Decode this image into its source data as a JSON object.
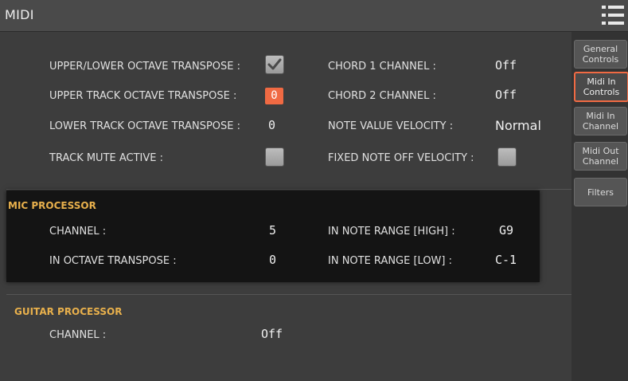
{
  "header": {
    "title": "MIDI",
    "menu_icon": "menu-list-icon"
  },
  "controls": {
    "upper_lower_octave_transpose": {
      "label": "UPPER/LOWER OCTAVE TRANSPOSE :",
      "checked": true
    },
    "upper_track_octave_transpose": {
      "label": "UPPER TRACK OCTAVE TRANSPOSE :",
      "value": "0"
    },
    "lower_track_octave_transpose": {
      "label": "LOWER TRACK OCTAVE TRANSPOSE :",
      "value": "0"
    },
    "track_mute_active": {
      "label": "TRACK MUTE ACTIVE :",
      "checked": false
    },
    "chord1_channel": {
      "label": "CHORD 1 CHANNEL :",
      "value": "Off"
    },
    "chord2_channel": {
      "label": "CHORD 2 CHANNEL :",
      "value": "Off"
    },
    "note_value_velocity": {
      "label": "NOTE VALUE VELOCITY :",
      "value": "Normal"
    },
    "fixed_note_off_velocity": {
      "label": "FIXED NOTE OFF VELOCITY :",
      "checked": false
    }
  },
  "mic_processor": {
    "title": "MIC PROCESSOR",
    "channel": {
      "label": "CHANNEL :",
      "value": "5"
    },
    "in_octave_transpose": {
      "label": "IN OCTAVE TRANSPOSE :",
      "value": "0"
    },
    "note_range_high": {
      "label": "IN NOTE RANGE [HIGH] :",
      "value": "G9"
    },
    "note_range_low": {
      "label": "IN NOTE RANGE [LOW] :",
      "value": "C-1"
    }
  },
  "guitar_processor": {
    "title": "GUITAR PROCESSOR",
    "channel": {
      "label": "CHANNEL :",
      "value": "Off"
    }
  },
  "tabs": [
    {
      "label": "General\nControls",
      "active": false
    },
    {
      "label": "Midi In\nControls",
      "active": true
    },
    {
      "label": "Midi In\nChannel",
      "active": false
    },
    {
      "label": "Midi Out\nChannel",
      "active": false
    },
    {
      "label": "Filters",
      "active": false
    }
  ],
  "colors": {
    "accent": "#f06a43",
    "section_title": "#e8b04c",
    "background": "#3c3c3c",
    "panel": "#141414"
  }
}
